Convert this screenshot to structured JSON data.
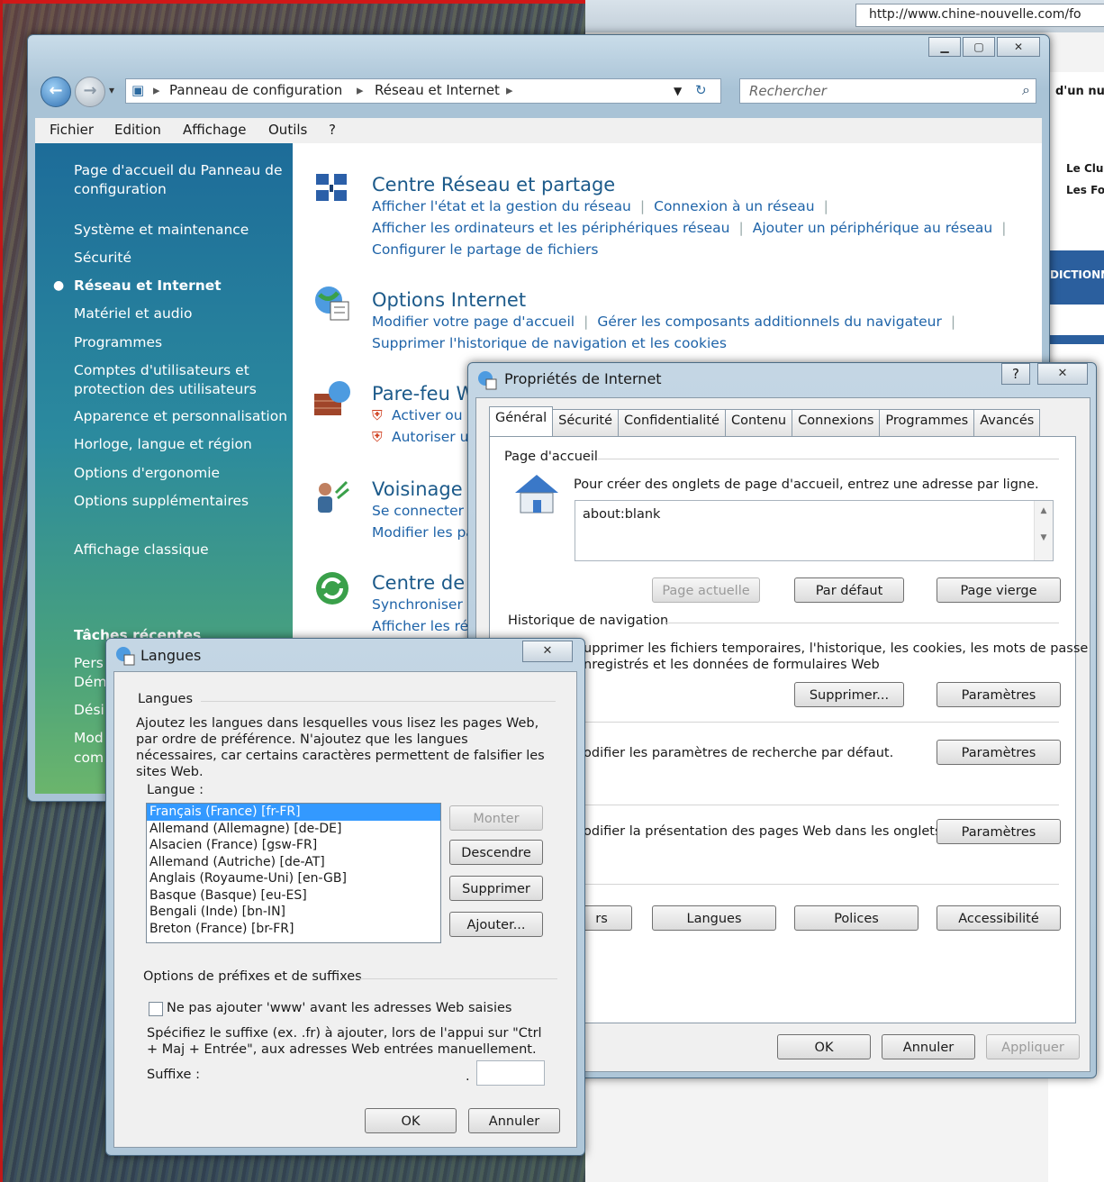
{
  "browser": {
    "url": "http://www.chine-nouvelle.com/fo",
    "side_texts": [
      "d'un nu",
      "Le Clu",
      "Les Fo",
      "DICTIONN"
    ]
  },
  "control_panel": {
    "breadcrumb": [
      "Panneau de configuration",
      "Réseau et Internet"
    ],
    "search_placeholder": "Rechercher",
    "menu": [
      "Fichier",
      "Edition",
      "Affichage",
      "Outils",
      "?"
    ],
    "sidebar": {
      "home": "Page d'accueil du Panneau de configuration",
      "items": [
        "Système et maintenance",
        "Sécurité",
        "Réseau et Internet",
        "Matériel et audio",
        "Programmes",
        "Comptes d'utilisateurs et protection des utilisateurs",
        "Apparence et personnalisation",
        "Horloge, langue et région",
        "Options d'ergonomie",
        "Options supplémentaires"
      ],
      "classic": "Affichage classique",
      "recent_title": "Tâches récentes",
      "recent_fragments": [
        "Pers",
        "Dém",
        "Dési",
        "Mod",
        "com"
      ]
    },
    "categories": [
      {
        "title": "Centre Réseau et partage",
        "links": [
          "Afficher l'état et la gestion du réseau",
          "Connexion à un réseau",
          "Afficher les ordinateurs et les périphériques réseau",
          "Ajouter un périphérique au réseau",
          "Configurer le partage de fichiers"
        ]
      },
      {
        "title": "Options Internet",
        "links": [
          "Modifier votre page d'accueil",
          "Gérer les composants additionnels du navigateur",
          "Supprimer l'historique de navigation et les cookies"
        ]
      },
      {
        "title": "Pare-feu W",
        "links": [
          "Activer ou",
          "Autoriser u"
        ]
      },
      {
        "title": "Voisinage r",
        "links": [
          "Se connecter à",
          "Modifier les pa"
        ]
      },
      {
        "title": "Centre de s",
        "links": [
          "Synchroniser a",
          "Afficher les rés"
        ]
      }
    ]
  },
  "internet_options": {
    "title": "Propriétés de Internet",
    "tabs": [
      "Général",
      "Sécurité",
      "Confidentialité",
      "Contenu",
      "Connexions",
      "Programmes",
      "Avancés"
    ],
    "home_group": "Page d'accueil",
    "home_desc": "Pour créer des onglets de page d'accueil, entrez une adresse par ligne.",
    "home_value": "about:blank",
    "btn_current": "Page actuelle",
    "btn_default": "Par défaut",
    "btn_blank": "Page vierge",
    "history_group": "Historique de navigation",
    "history_desc_1": "upprimer les fichiers temporaires, l'historique, les cookies, les mots de passe",
    "history_desc_2": "nregistrés et les données de formulaires Web",
    "btn_delete": "Supprimer...",
    "btn_settings": "Paramètres",
    "search_desc": "odifier les paramètres de recherche par défaut.",
    "tabs_desc": "odifier la présentation des pages Web dans les onglets",
    "btn_colors_frag": "rs",
    "btn_languages": "Langues",
    "btn_fonts": "Polices",
    "btn_access": "Accessibilité",
    "btn_ok": "OK",
    "btn_cancel": "Annuler",
    "btn_apply": "Appliquer"
  },
  "languages": {
    "title": "Langues",
    "group": "Langues",
    "desc": "Ajoutez les langues dans lesquelles vous lisez les pages Web, par ordre de préférence. N'ajoutez que les langues nécessaires, car certains caractères permettent de falsifier les sites Web.",
    "list_label": "Langue :",
    "items": [
      "Français (France) [fr-FR]",
      "Allemand (Allemagne) [de-DE]",
      "Alsacien (France) [gsw-FR]",
      "Allemand (Autriche) [de-AT]",
      "Anglais (Royaume-Uni) [en-GB]",
      "Basque (Basque) [eu-ES]",
      "Bengali (Inde) [bn-IN]",
      "Breton (France) [br-FR]"
    ],
    "btn_up": "Monter",
    "btn_down": "Descendre",
    "btn_remove": "Supprimer",
    "btn_add": "Ajouter...",
    "prefix_group": "Options de préfixes et de suffixes",
    "checkbox_label": "Ne pas ajouter 'www' avant les adresses Web saisies",
    "suffix_desc": "Spécifiez le suffixe (ex. .fr) à ajouter, lors de l'appui sur \"Ctrl + Maj + Entrée\", aux adresses Web entrées manuellement.",
    "suffix_label": "Suffixe :",
    "suffix_dot": ".",
    "btn_ok": "OK",
    "btn_cancel": "Annuler"
  }
}
